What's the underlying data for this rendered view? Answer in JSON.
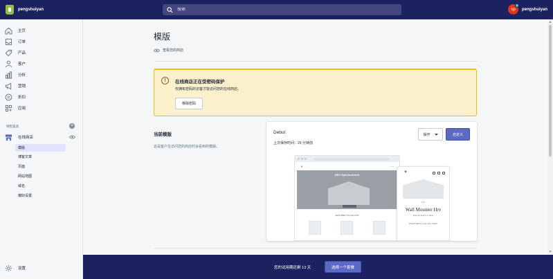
{
  "topbar": {
    "store_name": "pengshuiyan",
    "search_placeholder": "搜索",
    "avatar_initials": "sp",
    "user_name": "pengshuiyan"
  },
  "sidebar": {
    "items": [
      {
        "label": "主页",
        "icon": "home-icon"
      },
      {
        "label": "订单",
        "icon": "orders-icon"
      },
      {
        "label": "产品",
        "icon": "tag-icon"
      },
      {
        "label": "客户",
        "icon": "person-icon"
      },
      {
        "label": "分析",
        "icon": "bar-chart-icon"
      },
      {
        "label": "营销",
        "icon": "megaphone-icon"
      },
      {
        "label": "折扣",
        "icon": "discount-icon"
      },
      {
        "label": "应用",
        "icon": "apps-icon"
      }
    ],
    "channels_label": "销售渠道",
    "online_store_label": "在线商店",
    "sub_items": [
      "模版",
      "博客文章",
      "页面",
      "网站地图",
      "域名",
      "偏好设置"
    ],
    "settings_label": "设置"
  },
  "main": {
    "title": "模版",
    "view_store": "查看您的商店",
    "banner": {
      "title": "在线商店正在受密码保护",
      "description": "仅拥有密码的访客才能访问您的在线商店。",
      "button": "移除密码"
    },
    "current_theme": {
      "section_title": "当前模版",
      "section_desc": "这是客户在访问您的商店时会看到的模版。",
      "theme_name": "Debut",
      "last_saved": "上次保存时间：29 分钟前",
      "actions_button": "操作",
      "customize_button": "自定义"
    },
    "preview": {
      "desktop_hero_title": "HRV Synchronized",
      "desktop_feat": "FEATURED COLLECTION",
      "mobile_title": "Wall Mounter Hrv",
      "mobile_sub": "Enjoy the beauty of nature",
      "mobile_feat": "FEATURED COLLECTION"
    }
  },
  "trial": {
    "text": "您的试用期还剩 13 天",
    "button": "选择一个套餐"
  },
  "colors": {
    "topbar": "#1c2260",
    "primary": "#5c6ac4",
    "banner_bg": "#fcf1cd",
    "banner_border": "#eec200"
  }
}
